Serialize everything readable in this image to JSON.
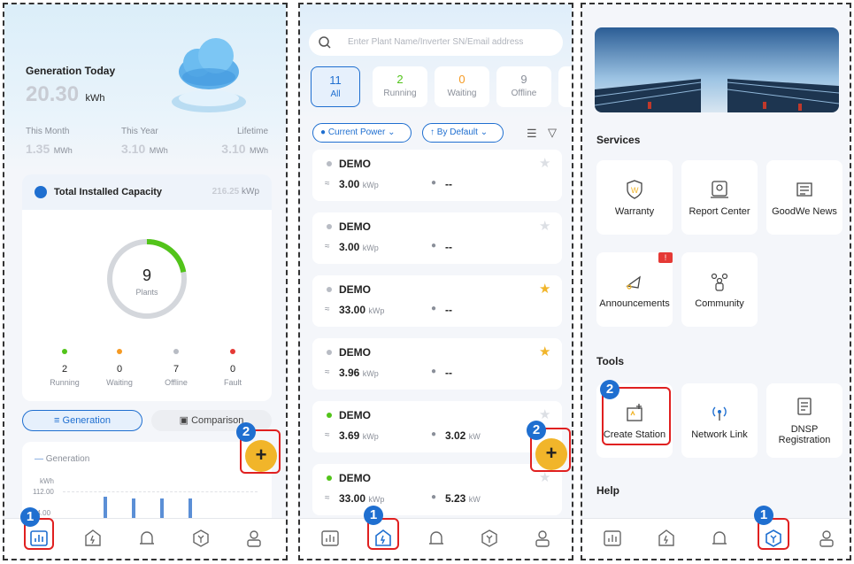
{
  "panel1": {
    "generation_title": "Generation Today",
    "generation_value": "20.30",
    "generation_unit": "kWh",
    "stats": [
      {
        "label": "This Month",
        "value": "1.35",
        "unit": "MWh"
      },
      {
        "label": "This Year",
        "value": "3.10",
        "unit": "MWh"
      },
      {
        "label": "Lifetime",
        "value": "3.10",
        "unit": "MWh"
      }
    ],
    "capacity_title": "Total Installed Capacity",
    "capacity_value": "216.25",
    "capacity_unit": "kWp",
    "plants_count": "9",
    "plants_label": "Plants",
    "donut_running_fraction": 0.22,
    "status": [
      {
        "label": "Running",
        "count": "2",
        "color": "#52c41a"
      },
      {
        "label": "Waiting",
        "count": "0",
        "color": "#f59a23"
      },
      {
        "label": "Offline",
        "count": "7",
        "color": "#b8bcc4"
      },
      {
        "label": "Fault",
        "count": "0",
        "color": "#e53935"
      }
    ],
    "tab_generation": "Generation",
    "tab_comparison": "Comparison",
    "chart_legend": "Generation",
    "chart_unit": "kWh",
    "chart_tick1": "112.00",
    "chart_tick2": "84.00"
  },
  "panel2": {
    "search_placeholder": "Enter Plant Name/Inverter SN/Email address",
    "filters": [
      {
        "count": "11",
        "label": "All",
        "color": "#1f6fd0"
      },
      {
        "count": "2",
        "label": "Running",
        "color": "#52c41a"
      },
      {
        "count": "0",
        "label": "Waiting",
        "color": "#f59a23"
      },
      {
        "count": "9",
        "label": "Offline",
        "color": "#8a8f99"
      }
    ],
    "sort_power": "Current Power",
    "sort_default": "By Default",
    "plants": [
      {
        "name": "DEMO",
        "capacity": "3.00",
        "cap_unit": "kWp",
        "power": "--",
        "power_unit": "",
        "online": false,
        "fav": false
      },
      {
        "name": "DEMO",
        "capacity": "3.00",
        "cap_unit": "kWp",
        "power": "--",
        "power_unit": "",
        "online": false,
        "fav": false
      },
      {
        "name": "DEMO",
        "capacity": "33.00",
        "cap_unit": "kWp",
        "power": "--",
        "power_unit": "",
        "online": false,
        "fav": true
      },
      {
        "name": "DEMO",
        "capacity": "3.96",
        "cap_unit": "kWp",
        "power": "--",
        "power_unit": "",
        "online": false,
        "fav": true
      },
      {
        "name": "DEMO",
        "capacity": "3.69",
        "cap_unit": "kWp",
        "power": "3.02",
        "power_unit": "kW",
        "online": true,
        "fav": false
      },
      {
        "name": "DEMO",
        "capacity": "33.00",
        "cap_unit": "kWp",
        "power": "5.23",
        "power_unit": "kW",
        "online": true,
        "fav": false
      }
    ]
  },
  "panel3": {
    "services_title": "Services",
    "services": [
      {
        "label": "Warranty",
        "icon": "warranty-icon"
      },
      {
        "label": "Report Center",
        "icon": "report-icon"
      },
      {
        "label": "GoodWe News",
        "icon": "news-icon"
      },
      {
        "label": "Announcements",
        "icon": "announcement-icon",
        "badge": "!"
      },
      {
        "label": "Community",
        "icon": "community-icon"
      }
    ],
    "tools_title": "Tools",
    "tools": [
      {
        "label": "Create Station",
        "icon": "create-station-icon"
      },
      {
        "label": "Network Link",
        "icon": "network-link-icon"
      },
      {
        "label": "DNSP Registration",
        "icon": "dnsp-icon"
      }
    ],
    "help_title": "Help"
  },
  "markers": {
    "one": "1",
    "two": "2"
  },
  "fab_label": "+",
  "colors": {
    "accent": "#1f6fd0",
    "highlight": "#e02020",
    "fab": "#f1b52a"
  }
}
